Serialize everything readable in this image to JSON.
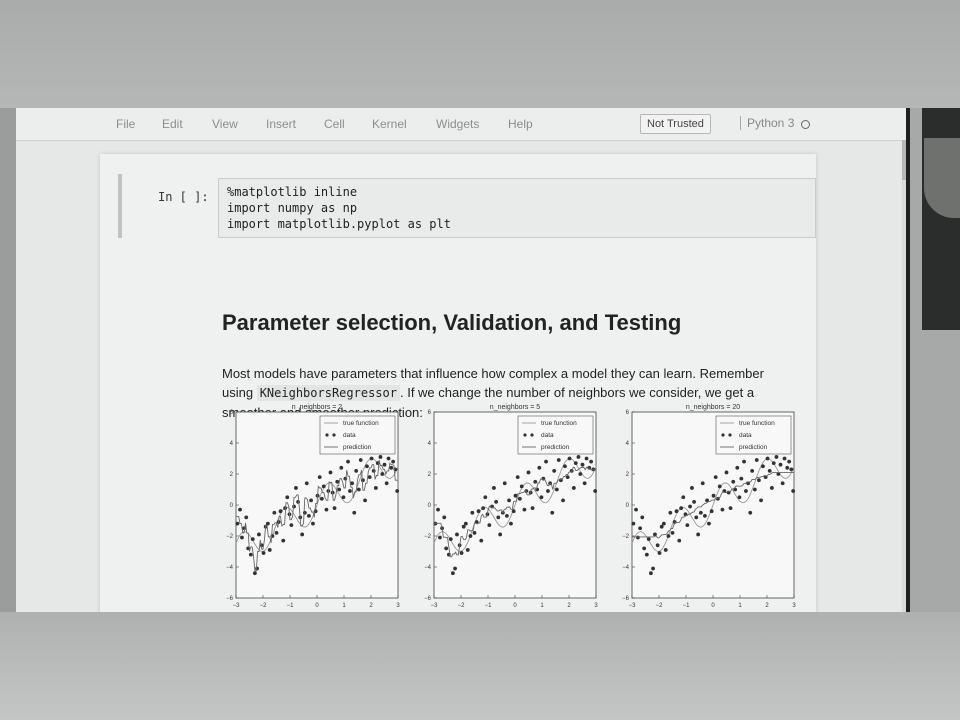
{
  "menu": {
    "items": [
      "File",
      "Edit",
      "View",
      "Insert",
      "Cell",
      "Kernel",
      "Widgets",
      "Help"
    ]
  },
  "status": {
    "trusted": "Not Trusted",
    "kernel": "Python 3"
  },
  "code_cell": {
    "prompt": "In [ ]:",
    "lines": [
      "%matplotlib inline",
      "import numpy as np",
      "import matplotlib.pyplot as plt"
    ]
  },
  "markdown": {
    "title": "Parameter selection, Validation, and Testing",
    "para_before": "Most models have parameters that influence how complex a model they can learn. Remember using ",
    "code": "KNeighborsRegressor",
    "para_after": ". If we change the number of neighbors we consider, we get a smoother and smoother prediction:"
  },
  "chart_data": [
    {
      "type": "scatter",
      "title": "n_neighbors = 2",
      "legend": [
        "true function",
        "data",
        "prediction"
      ],
      "legend_position": "top-right",
      "xlim": [
        -3,
        3
      ],
      "ylim": [
        -6,
        6
      ],
      "xticks": [
        -3,
        -2,
        -1,
        0,
        1,
        2,
        3
      ],
      "yticks": [
        -6,
        -4,
        -2,
        0,
        2,
        4,
        6
      ]
    },
    {
      "type": "scatter",
      "title": "n_neighbors = 5",
      "legend": [
        "true function",
        "data",
        "prediction"
      ],
      "legend_position": "top-right",
      "xlim": [
        -3,
        3
      ],
      "ylim": [
        -6,
        6
      ],
      "xticks": [
        -3,
        -2,
        -1,
        0,
        1,
        2,
        3
      ],
      "yticks": [
        -6,
        -4,
        -2,
        0,
        2,
        4,
        6
      ]
    },
    {
      "type": "scatter",
      "title": "n_neighbors = 20",
      "legend": [
        "true function",
        "data",
        "prediction"
      ],
      "legend_position": "top-right",
      "xlim": [
        -3,
        3
      ],
      "ylim": [
        -6,
        6
      ],
      "xticks": [
        -3,
        -2,
        -1,
        0,
        1,
        2,
        3
      ],
      "yticks": [
        -6,
        -4,
        -2,
        0,
        2,
        4,
        6
      ]
    }
  ],
  "plot_data": {
    "x": [
      -2.95,
      -2.85,
      -2.78,
      -2.7,
      -2.62,
      -2.55,
      -2.45,
      -2.38,
      -2.3,
      -2.22,
      -2.15,
      -2.05,
      -1.98,
      -1.9,
      -1.82,
      -1.75,
      -1.65,
      -1.58,
      -1.5,
      -1.42,
      -1.35,
      -1.25,
      -1.18,
      -1.1,
      -1.02,
      -0.95,
      -0.85,
      -0.78,
      -0.7,
      -0.62,
      -0.55,
      -0.45,
      -0.38,
      -0.3,
      -0.22,
      -0.15,
      -0.05,
      0.02,
      0.1,
      0.18,
      0.25,
      0.35,
      0.42,
      0.5,
      0.58,
      0.65,
      0.75,
      0.82,
      0.9,
      0.98,
      1.05,
      1.15,
      1.22,
      1.3,
      1.38,
      1.45,
      1.55,
      1.62,
      1.7,
      1.78,
      1.85,
      1.95,
      2.02,
      2.1,
      2.18,
      2.25,
      2.35,
      2.42,
      2.5,
      2.58,
      2.65,
      2.75,
      2.82,
      2.9,
      2.97
    ],
    "y": [
      -1.2,
      -0.3,
      -2.1,
      -1.5,
      -0.8,
      -2.8,
      -3.2,
      -2.2,
      -4.4,
      -4.1,
      -1.9,
      -2.6,
      -3.1,
      -1.4,
      -1.2,
      -2.9,
      -2.0,
      -0.5,
      -1.8,
      -1.1,
      -0.4,
      -2.3,
      -0.2,
      0.5,
      -0.6,
      -1.3,
      -0.1,
      1.1,
      0.2,
      -0.8,
      -1.9,
      -0.5,
      1.4,
      -0.7,
      0.3,
      -1.2,
      -0.4,
      0.6,
      1.8,
      0.4,
      1.2,
      -0.3,
      0.9,
      2.1,
      0.8,
      -0.2,
      1.5,
      1.0,
      2.4,
      0.5,
      1.7,
      2.8,
      0.9,
      1.4,
      -0.5,
      2.2,
      1.0,
      2.9,
      1.6,
      0.3,
      2.5,
      1.8,
      3.0,
      2.2,
      1.1,
      2.7,
      3.1,
      2.0,
      2.6,
      1.4,
      3.0,
      2.4,
      2.8,
      2.3,
      0.9
    ]
  }
}
